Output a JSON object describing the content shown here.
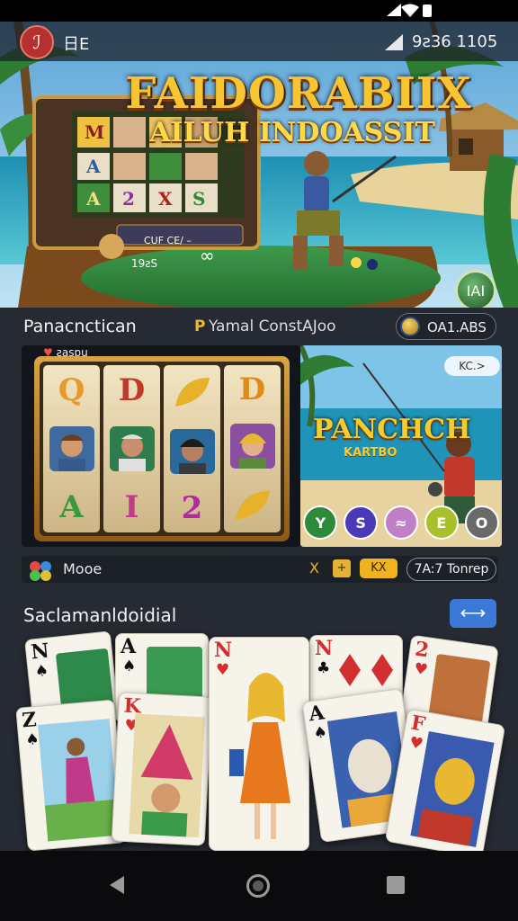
{
  "status_bar": {},
  "header": {
    "app_title": "日E",
    "clock": "9ƨ36 1105",
    "logo_icon": "brand-logo-icon"
  },
  "hero": {
    "title": "FAIDORABIIX",
    "subtitle": "AILUH INDOASSIT",
    "machine_label": "CUF CE/ –",
    "counter": "19ƨS",
    "badge": "IAI"
  },
  "section1": {
    "title": "Panacnctican",
    "mid_icon": "P",
    "mid_text": "Yamal ConstAJoo",
    "chip_text": "OA1.ABS",
    "slot_label": "ƨasɒu",
    "fish_title": "PANCHCH",
    "fish_sub": "KARTBO",
    "fish_pill": "KC.>",
    "bubbles": [
      "Y",
      "S",
      "≈",
      "E",
      "O"
    ],
    "reels": [
      [
        "Q",
        "face",
        "A"
      ],
      [
        "D",
        "face",
        "I"
      ],
      [
        "leaf",
        "face",
        "2"
      ],
      [
        "D",
        "face",
        "leaf"
      ]
    ],
    "mode": "Mooe",
    "tag_x": "X",
    "tag_sq": "+",
    "tag_kx": "KX",
    "right_text": "7A:7 Tonrep"
  },
  "section2": {
    "title": "Saclamanldoidial",
    "button_icon": "⟷",
    "cards": [
      {
        "rank": "N",
        "suit": "♠",
        "color": "black"
      },
      {
        "rank": "A",
        "suit": "♠",
        "color": "black"
      },
      {
        "rank": "N",
        "suit": "♥",
        "color": "red"
      },
      {
        "rank": "N",
        "suit": "♣",
        "color": "black"
      },
      {
        "rank": "2",
        "suit": "♥",
        "color": "red"
      },
      {
        "rank": "Z",
        "suit": "♠",
        "color": "black"
      },
      {
        "rank": "K",
        "suit": "♥",
        "color": "red"
      },
      {
        "rank": "A",
        "suit": "♠",
        "color": "black"
      },
      {
        "rank": "F",
        "suit": "♥",
        "color": "red"
      }
    ]
  },
  "colors": {
    "accent": "#3b78d8",
    "gold": "#f6c531",
    "panel": "#262a33"
  }
}
